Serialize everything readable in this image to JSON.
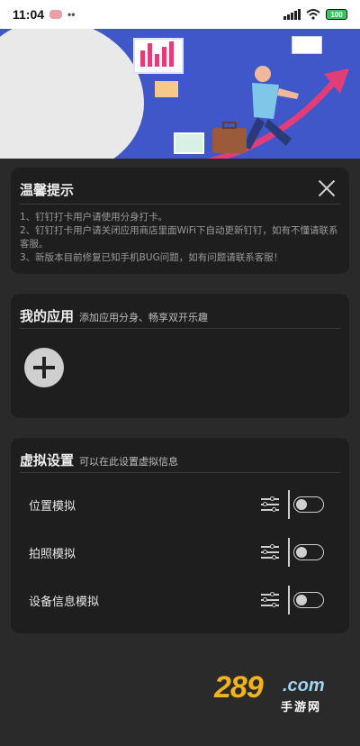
{
  "status_bar": {
    "time": "11:04",
    "dots": "••",
    "battery": "100"
  },
  "tips": {
    "title": "温馨提示",
    "lines": [
      "1、钉钉打卡用户请使用分身打卡。",
      "2、钉钉打卡用户请关闭应用商店里面WiFi下自动更新钉钉，如有不懂请联系客服。",
      "3、新版本目前修复已知手机BUG问题，如有问题请联系客服！"
    ]
  },
  "my_apps": {
    "title": "我的应用",
    "subtitle": "添加应用分身、畅享双开乐趣"
  },
  "virtual_settings": {
    "title": "虚拟设置",
    "subtitle": "可以在此设置虚拟信息",
    "rows": [
      {
        "label": "位置模拟",
        "enabled": false
      },
      {
        "label": "拍照模拟",
        "enabled": false
      },
      {
        "label": "设备信息模拟",
        "enabled": false
      }
    ]
  },
  "watermark": {
    "number": "289",
    "domain": ".com",
    "name": "手游网"
  },
  "colors": {
    "background": "#2a2a2a",
    "card": "#1e1e1e",
    "banner": "#3f57c8",
    "accent_pink": "#e23d77",
    "watermark_orange": "#f2b21a"
  }
}
